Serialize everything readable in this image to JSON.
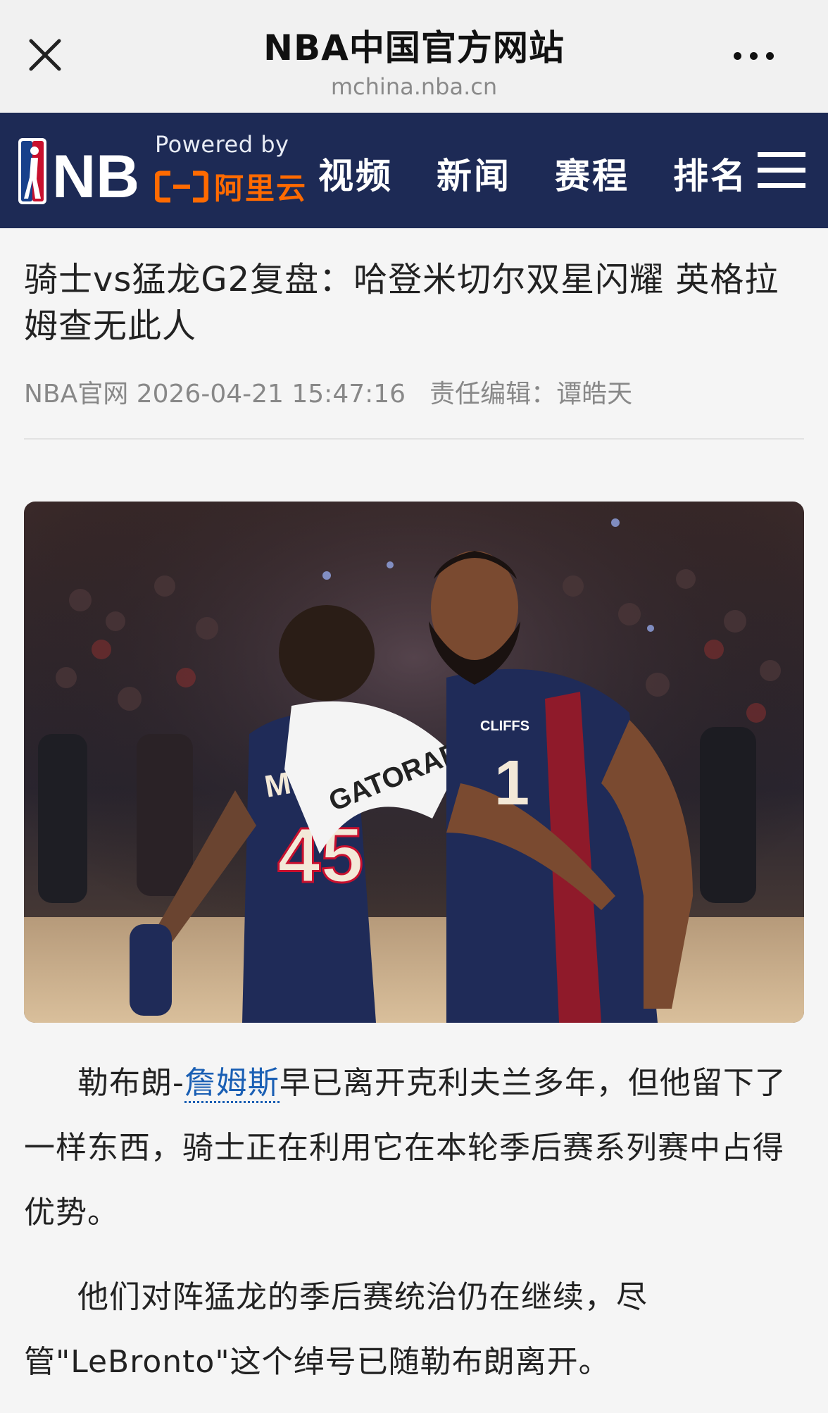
{
  "browser": {
    "title": "NBA中国官方网站",
    "url": "mchina.nba.cn"
  },
  "nav": {
    "logo_text": "NBA",
    "powered_by": "Powered by",
    "partner": "阿里云",
    "items": [
      {
        "label": "视频"
      },
      {
        "label": "新闻"
      },
      {
        "label": "赛程"
      },
      {
        "label": "排名"
      }
    ]
  },
  "article": {
    "title": "骑士vs猛龙G2复盘：哈登米切尔双星闪耀 英格拉姆查无此人",
    "source": "NBA官网",
    "datetime": "2026-04-21 15:47:16",
    "editor": "责任编辑：谭皓天",
    "paragraph1": {
      "prefix": "勒布朗-",
      "link": "詹姆斯",
      "suffix": "早已离开克利夫兰多年，但他留下了一样东西，骑士正在利用它在本轮季后赛系列赛中占得优势。"
    },
    "paragraph2": "他们对阵猛龙的季后赛统治仍在继续，尽管\"LeBronto\"这个绰号已随勒布朗离开。",
    "image": {
      "jersey_number_left": "45",
      "jersey_name_left": "MITC",
      "towel_text": "GATORADE",
      "sponsor_patch": "CLIFFS",
      "jersey_number_right": "1"
    }
  },
  "colors": {
    "navbar_bg": "#1d2a55",
    "aliyun_orange": "#ff6a00",
    "link_blue": "#1a5fb4",
    "nba_red": "#c8102e",
    "nba_blue": "#17408b"
  },
  "icons": [
    "close-icon",
    "more-icon",
    "nba-logo-icon",
    "aliyun-logo-icon",
    "menu-icon"
  ]
}
